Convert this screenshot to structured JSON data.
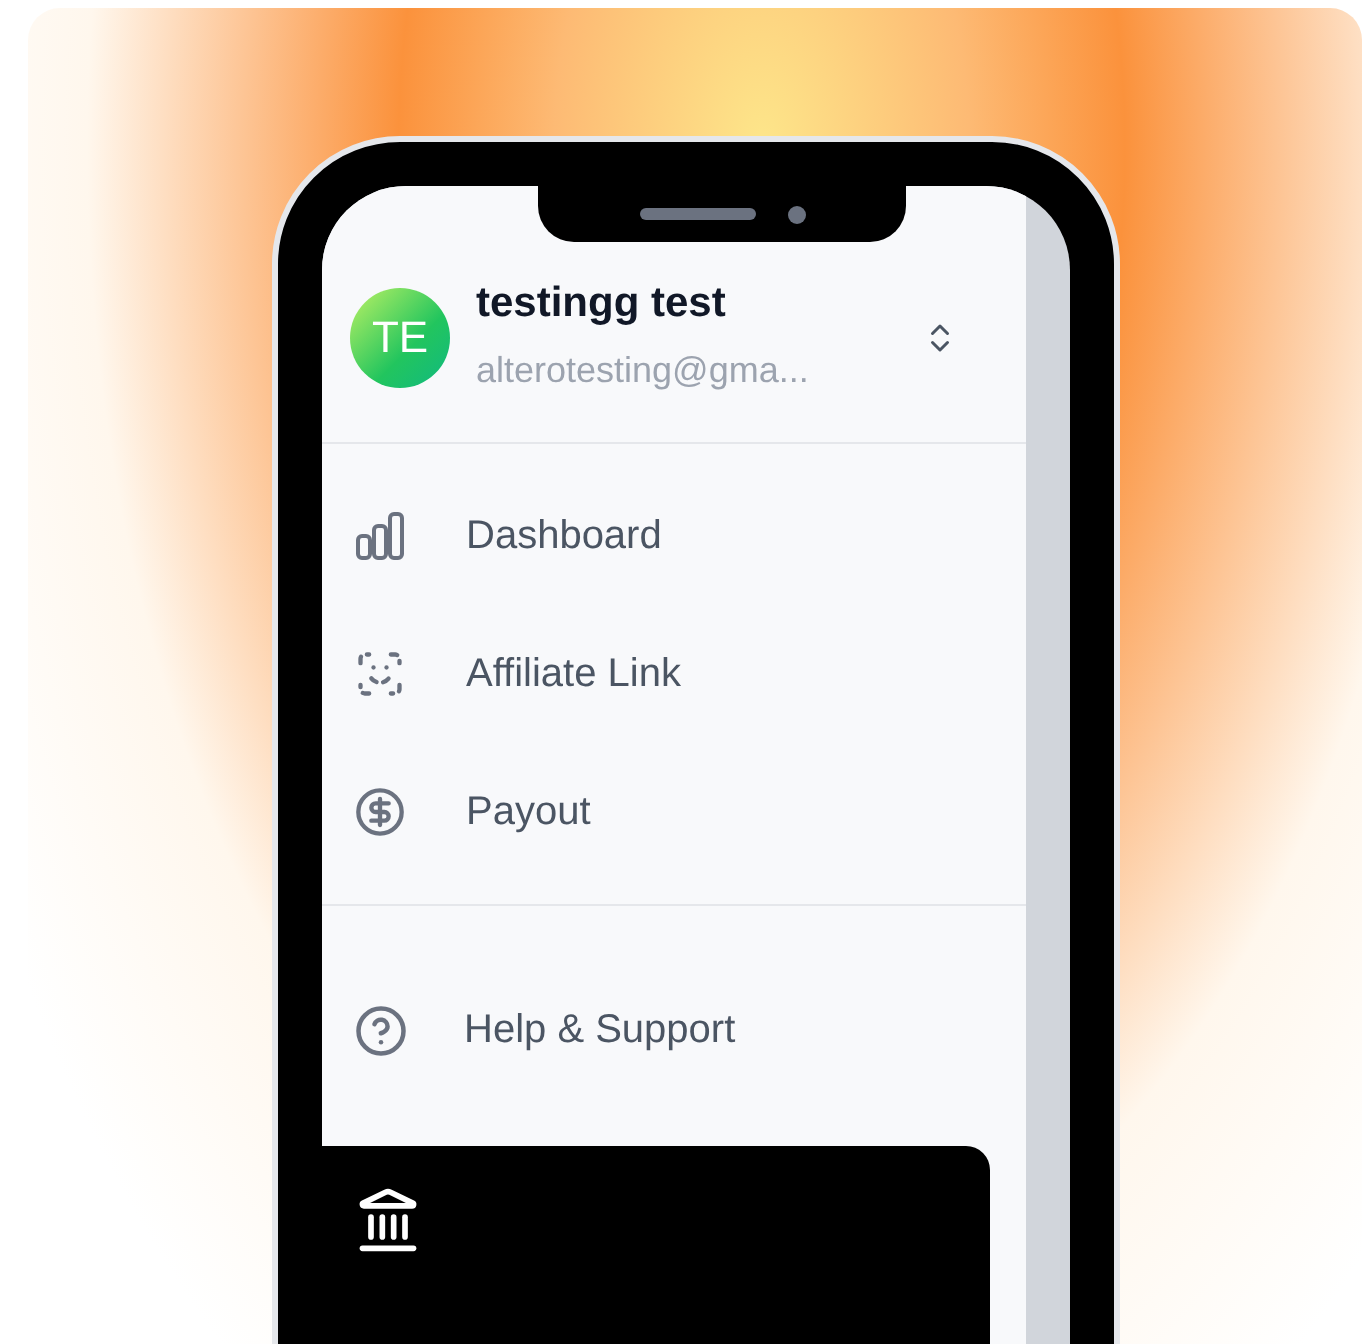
{
  "user": {
    "initials": "TE",
    "name": "testingg test",
    "email": "alterotesting@gma..."
  },
  "nav": [
    {
      "label": "Dashboard"
    },
    {
      "label": "Affiliate Link"
    },
    {
      "label": "Payout"
    }
  ],
  "support": {
    "label": "Help & Support"
  }
}
